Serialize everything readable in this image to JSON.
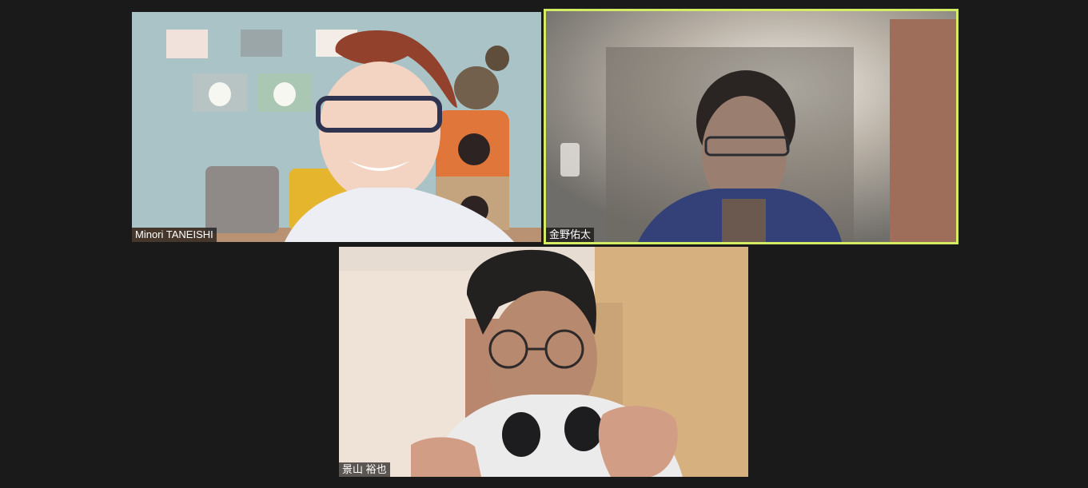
{
  "meeting": {
    "layout": "gallery",
    "active_speaker_color": "#d4ec63",
    "participants": [
      {
        "name": "Minori TANEISHI",
        "active_speaker": false
      },
      {
        "name": "金野佑太",
        "active_speaker": true
      },
      {
        "name": "景山 裕也",
        "active_speaker": false
      }
    ]
  }
}
